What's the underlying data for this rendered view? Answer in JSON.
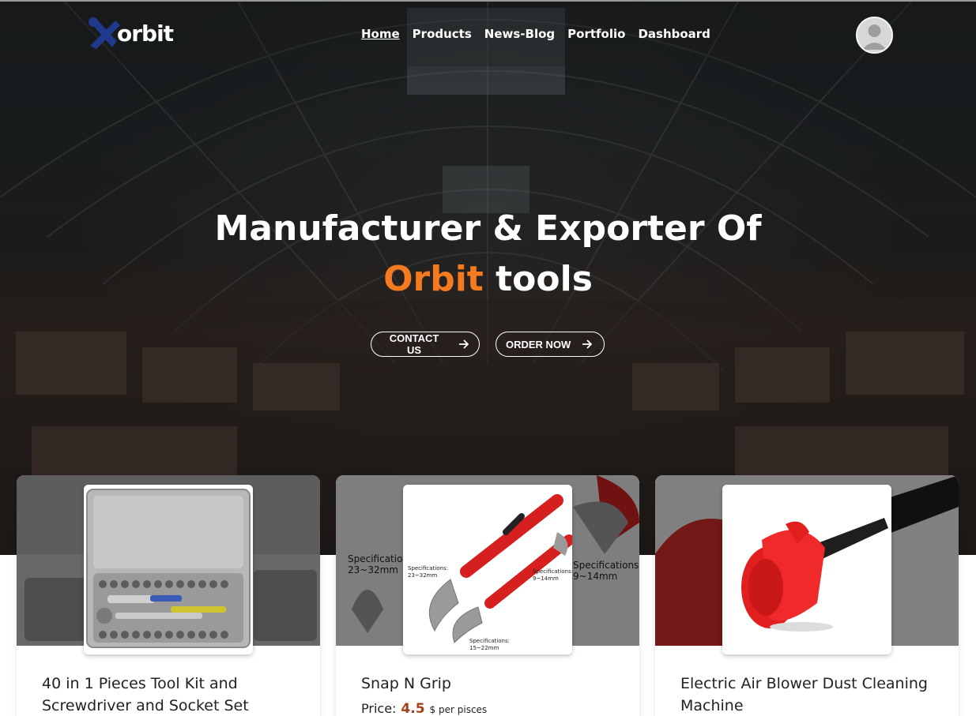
{
  "brand": {
    "name": "orbit"
  },
  "nav": {
    "items": [
      {
        "label": "Home",
        "active": true
      },
      {
        "label": "Products"
      },
      {
        "label": "News-Blog"
      },
      {
        "label": "Portfolio"
      },
      {
        "label": "Dashboard"
      }
    ]
  },
  "hero": {
    "line1": "Manufacturer & Exporter Of",
    "accent_word": "Orbit",
    "line2_rest": " tools",
    "buttons": {
      "contact": "CONTACT US",
      "order": "ORDER NOW"
    },
    "accent_color": "#f47a20"
  },
  "products": [
    {
      "title": "40 in 1 Pieces Tool Kit and Screwdriver and Socket Set"
    },
    {
      "title": "Snap N Grip",
      "price_label": "Price:",
      "price_value": "4.5",
      "price_unit": "$ per pisces",
      "spec_large": "Specifications:",
      "spec_large_a": "23~32mm",
      "spec_large_b": "9~14mm",
      "spec_1": "Specifications:",
      "spec_1_v": "23~32mm",
      "spec_2": "Specifications:",
      "spec_2_v": "9~14mm",
      "spec_3": "Specifications:",
      "spec_3_v": "15~22mm"
    },
    {
      "title": "Electric Air Blower Dust Cleaning Machine"
    }
  ],
  "icons": {
    "logo": "wrench-logo-icon",
    "avatar": "user-avatar-icon",
    "arrow": "arrow-right-icon"
  }
}
